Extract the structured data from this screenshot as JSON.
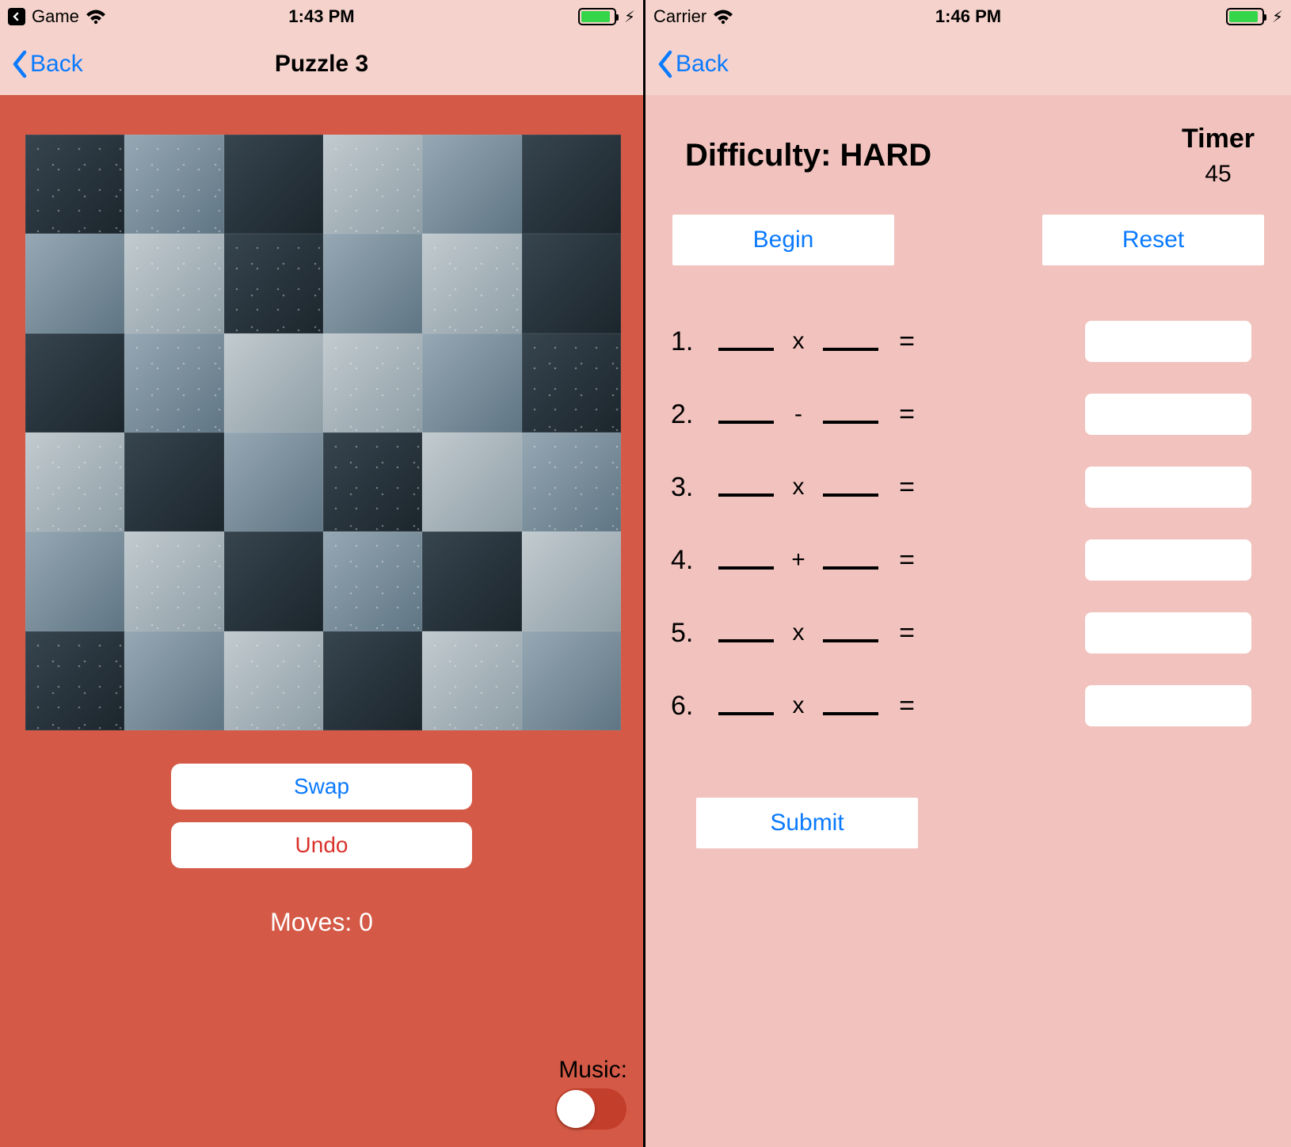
{
  "left": {
    "status": {
      "app_name": "Game",
      "time": "1:43 PM",
      "battery_pct": 90
    },
    "nav": {
      "back_label": "Back",
      "title": "Puzzle 3"
    },
    "buttons": {
      "swap": "Swap",
      "undo": "Undo"
    },
    "moves_label": "Moves: 0",
    "music_label": "Music:",
    "music_on": false,
    "grid": {
      "rows": 6,
      "cols": 6
    }
  },
  "right": {
    "status": {
      "carrier": "Carrier",
      "time": "1:46 PM",
      "battery_pct": 90
    },
    "nav": {
      "back_label": "Back"
    },
    "difficulty_label": "Difficulty: HARD",
    "timer": {
      "label": "Timer",
      "value": "45"
    },
    "buttons": {
      "begin": "Begin",
      "reset": "Reset",
      "submit": "Submit"
    },
    "problems": [
      {
        "num": "1.",
        "op": "x"
      },
      {
        "num": "2.",
        "op": "-"
      },
      {
        "num": "3.",
        "op": "x"
      },
      {
        "num": "4.",
        "op": "+"
      },
      {
        "num": "5.",
        "op": "x"
      },
      {
        "num": "6.",
        "op": "x"
      }
    ]
  }
}
